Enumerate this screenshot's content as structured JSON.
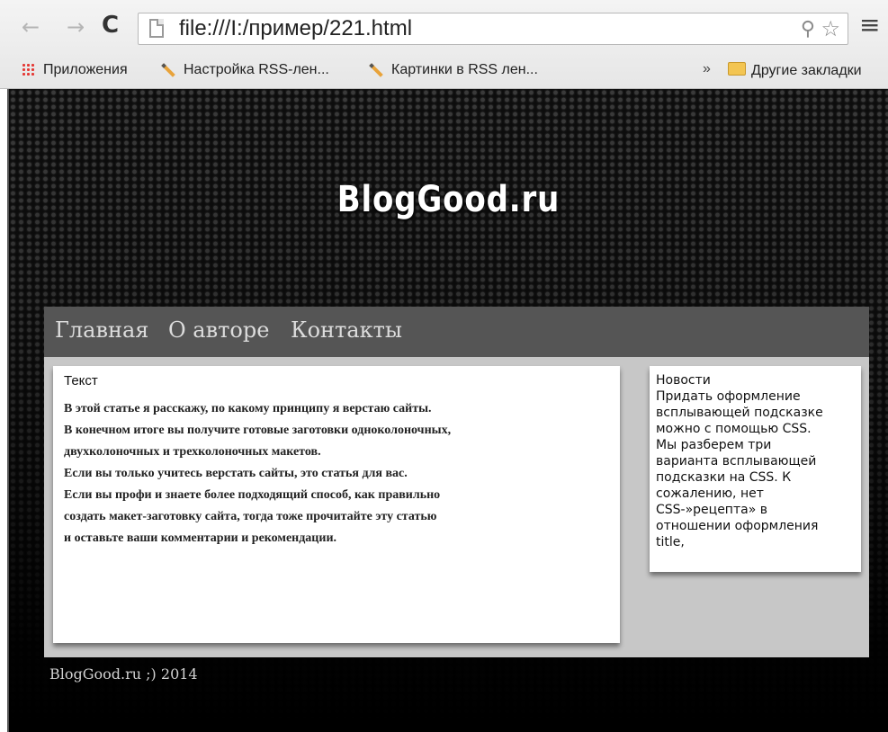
{
  "browser": {
    "url": "file:///I:/пример/221.html",
    "bookmarks": {
      "apps": "Приложения",
      "item1": "Настройка RSS-лен...",
      "item2": "Картинки в RSS лен...",
      "more": "»",
      "other": "Другие закладки"
    }
  },
  "site": {
    "title": "BlogGood.ru",
    "menu": [
      "Главная",
      "О авторе",
      "Контакты"
    ],
    "content": {
      "heading": "Текст",
      "lines": [
        "В этой статье я расскажу, по какому принципу я верстаю сайты.",
        "В конечном итоге вы получите готовые заготовки одноколоночных,",
        "двухколоночных и трехколоночных макетов.",
        "Если вы только учитесь верстать сайты, это статья для вас.",
        "Если вы профи и знаете более подходящий способ, как правильно",
        "создать макет-заготовку сайта, тогда тоже прочитайте эту статью",
        "и оставьте ваши комментарии и рекомендации."
      ]
    },
    "sidebar": {
      "heading": "Новости",
      "lines": [
        "Придать оформление",
        "всплывающей подсказке",
        "можно с помощью CSS.",
        "Мы разберем три",
        "варианта всплывающей",
        "подсказки на CSS. К",
        "сожалению, нет",
        "CSS-»рецепта» в",
        "отношении оформления",
        "title,"
      ]
    },
    "footer": "BlogGood.ru ;) 2014"
  }
}
